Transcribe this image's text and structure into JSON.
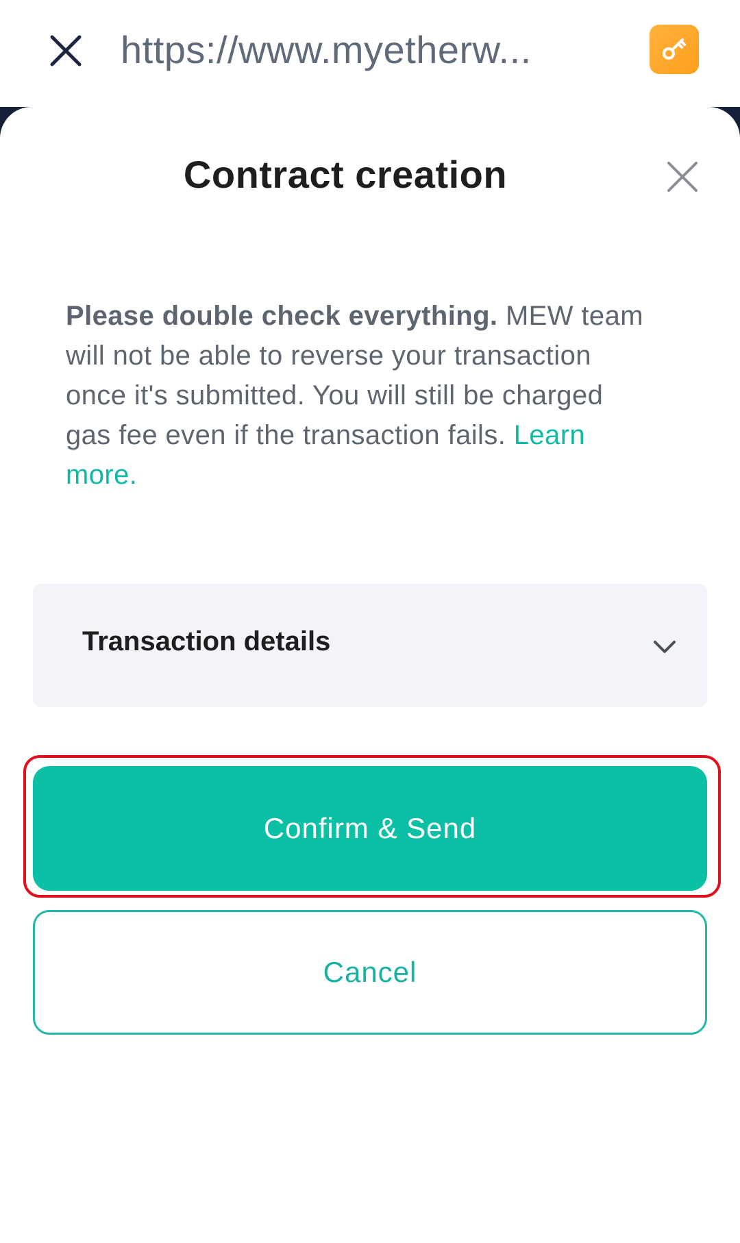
{
  "browser": {
    "url": "https://www.myetherw...",
    "close_icon": "close-icon",
    "key_icon": "key-icon",
    "key_color": "#ffa726"
  },
  "dialog": {
    "title": "Contract creation",
    "close_icon": "close-icon",
    "notice_bold": "Please double check everything.",
    "notice_text": " MEW team will not be able to reverse your transaction once it's submitted. You will still be charged gas fee even if the transaction fails. ",
    "learn_more": "Learn more.",
    "details_label": "Transaction details",
    "details_icon": "chevron-down-icon",
    "confirm_label": "Confirm & Send",
    "cancel_label": "Cancel"
  },
  "colors": {
    "accent": "#0cc0a6",
    "highlight": "#e0101d",
    "backdrop": "#172039"
  }
}
